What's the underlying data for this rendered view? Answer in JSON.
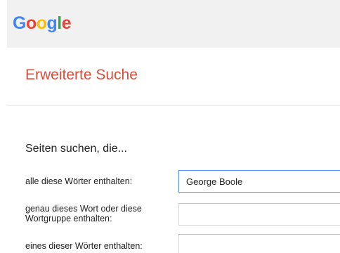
{
  "brand": {
    "logo_letters": [
      {
        "char": "G",
        "color": "#4285f4"
      },
      {
        "char": "o",
        "color": "#ea4335"
      },
      {
        "char": "o",
        "color": "#fbbc05"
      },
      {
        "char": "g",
        "color": "#4285f4"
      },
      {
        "char": "l",
        "color": "#34a853"
      },
      {
        "char": "e",
        "color": "#ea4335"
      }
    ]
  },
  "header": {
    "title": "Erweiterte Suche"
  },
  "form": {
    "section_heading": "Seiten suchen, die...",
    "fields": [
      {
        "label": "alle diese Wörter enthalten:",
        "value": "George Boole"
      },
      {
        "label": "genau dieses Wort oder diese Wortgruppe enthalten:",
        "value": ""
      },
      {
        "label": "eines dieser Wörter enthalten:",
        "value": ""
      }
    ]
  },
  "colors": {
    "title": "#dd4b39",
    "topbar_bg": "#f1f1f1",
    "input_focus_border": "#4d90fe"
  }
}
